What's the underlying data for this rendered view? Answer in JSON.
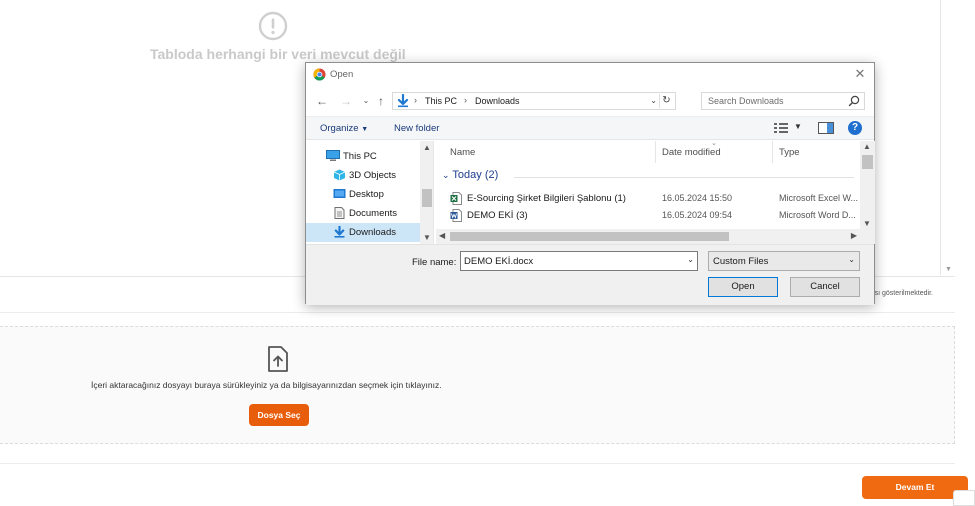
{
  "background": {
    "empty_message": "Tabloda herhangi bir veri mevcut değil",
    "info_text": "arası gösterilmektedir.",
    "upload_instruction": "İçeri aktaracağınız dosyayı buraya sürükleyiniz ya da bilgisayarınızdan seçmek için tıklayınız.",
    "choose_file_label": "Dosya Seç",
    "continue_label": "Devam Et",
    "accent_color": "#f06a12"
  },
  "dialog": {
    "title": "Open",
    "address": {
      "crumbs": [
        "This PC",
        "Downloads"
      ],
      "separator": "›"
    },
    "search_placeholder": "Search Downloads",
    "toolbar": {
      "organize_label": "Organize",
      "new_folder_label": "New folder"
    },
    "nav_items": [
      {
        "label": "This PC",
        "icon": "computer-icon"
      },
      {
        "label": "3D Objects",
        "icon": "3d-objects-icon"
      },
      {
        "label": "Desktop",
        "icon": "desktop-icon"
      },
      {
        "label": "Documents",
        "icon": "documents-icon"
      },
      {
        "label": "Downloads",
        "icon": "downloads-icon",
        "selected": true
      }
    ],
    "columns": {
      "name": "Name",
      "date_modified": "Date modified",
      "type": "Type"
    },
    "group_label": "Today (2)",
    "files": [
      {
        "name": "E-Sourcing Şirket Bilgileri Şablonu (1)",
        "date": "16.05.2024 15:50",
        "type": "Microsoft Excel W...",
        "icon": "excel-file-icon"
      },
      {
        "name": "DEMO EKİ (3)",
        "date": "16.05.2024 09:54",
        "type": "Microsoft Word D...",
        "icon": "word-file-icon"
      }
    ],
    "file_name_label": "File name:",
    "file_name_value": "DEMO EKİ.docx",
    "file_type_filter": "Custom Files",
    "open_label": "Open",
    "cancel_label": "Cancel"
  }
}
